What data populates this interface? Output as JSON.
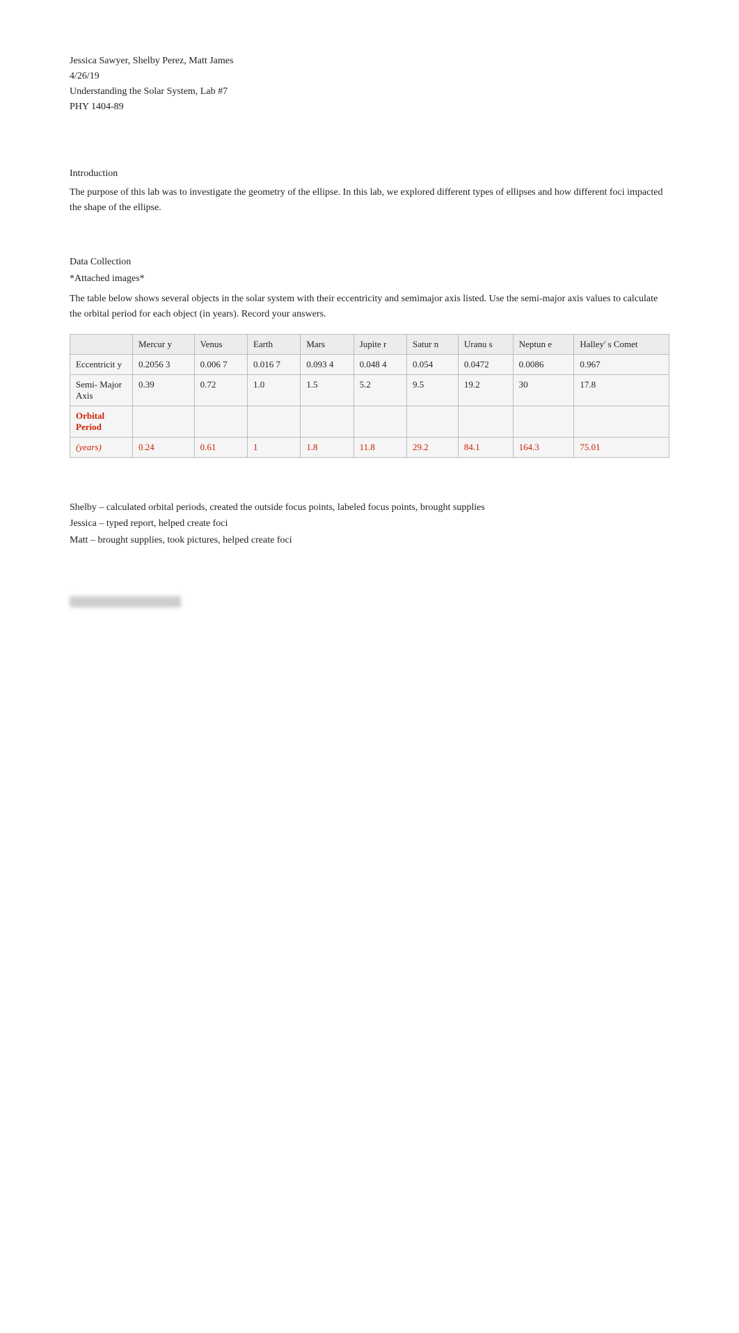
{
  "header": {
    "authors": "Jessica Sawyer, Shelby Perez, Matt James",
    "date": "4/26/19",
    "lab_title": "Understanding the Solar System, Lab #7",
    "course": "PHY 1404-89"
  },
  "sections": {
    "introduction_title": "Introduction",
    "introduction_body": "The purpose of this lab was to investigate the geometry of the ellipse. In this lab, we explored different types of ellipses and how different foci impacted the shape of the ellipse.",
    "data_collection_title": "Data Collection",
    "attached": "*Attached images*",
    "table_description": "The table below shows several objects in the solar system with their eccentricity and semimajor axis listed. Use the semi-major axis values to calculate the orbital period for each object (in years). Record your answers."
  },
  "table": {
    "columns": [
      {
        "id": "label",
        "header": ""
      },
      {
        "id": "mercury",
        "header": "Mercury"
      },
      {
        "id": "venus",
        "header": "Venus"
      },
      {
        "id": "earth",
        "header": "Earth"
      },
      {
        "id": "mars",
        "header": "Mars"
      },
      {
        "id": "jupiter",
        "header": "Jupiter"
      },
      {
        "id": "saturn",
        "header": "Saturn"
      },
      {
        "id": "uranus",
        "header": "Uranus"
      },
      {
        "id": "neptune",
        "header": "Neptune"
      },
      {
        "id": "halley",
        "header": "Halley's Comet"
      }
    ],
    "rows": [
      {
        "label": "Eccentricity",
        "values": [
          "0.2056 3",
          "0.006 7",
          "0.016 7",
          "0.093 4",
          "0.048 4",
          "0.054",
          "0.0472",
          "0.0086",
          "0.967"
        ]
      },
      {
        "label": "Semi-Major Axis",
        "values": [
          "0.39",
          "0.72",
          "1.0",
          "1.5",
          "5.2",
          "9.5",
          "19.2",
          "30",
          "17.8"
        ]
      },
      {
        "label": "Orbital Period",
        "is_orbital": true,
        "values": [
          "",
          "",
          "",
          "",
          "",
          "",
          "",
          "",
          ""
        ]
      },
      {
        "label": "(years)",
        "is_years": true,
        "values": [
          "0.24",
          "0.61",
          "1",
          "1.8",
          "11.8",
          "29.2",
          "84.1",
          "164.3",
          "75.01"
        ]
      }
    ]
  },
  "contributions": {
    "shelby": "Shelby – calculated orbital periods, created the outside focus points, labeled focus points, brought supplies",
    "jessica": "Jessica – typed report, helped create foci",
    "matt": "Matt – brought supplies, took pictures, helped create foci"
  }
}
